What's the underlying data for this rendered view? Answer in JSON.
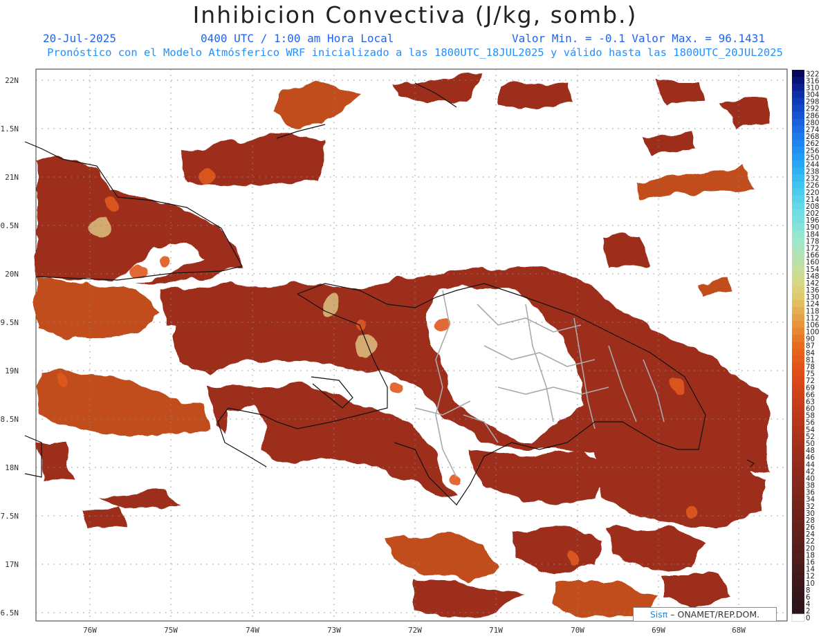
{
  "header": {
    "title": "Inhibicion Convectiva (J/kg, somb.)",
    "date": "20-Jul-2025",
    "valid_time": "0400 UTC / 1:00 am Hora Local",
    "min_max": "Valor Min. = -0.1  Valor Max. = 96.1431",
    "model_info": "Pronóstico con el Modelo Atmósferico WRF inicializado a las 1800UTC_18JUL2025 y válido hasta las  1800UTC_20JUL2025"
  },
  "colors": {
    "header_text": "#1e64f0",
    "model_text": "#1e90ff",
    "field_dark": "#9e2f1a",
    "field_mid": "#c24e1c",
    "field_bright": "#e05a1e",
    "field_light": "#d8b97a",
    "coast": "#111111",
    "borders": "#aaaaaa"
  },
  "map": {
    "lat_labels": [
      "22N",
      "1.5N",
      "21N",
      "0.5N",
      "20N",
      "9.5N",
      "19N",
      "8.5N",
      "18N",
      "7.5N",
      "17N",
      "6.5N"
    ],
    "lon_labels": [
      "76W",
      "75W",
      "74W",
      "73W",
      "72W",
      "71W",
      "70W",
      "69W",
      "68W"
    ]
  },
  "colorbar": {
    "labels": [
      "322",
      "316",
      "310",
      "304",
      "298",
      "292",
      "286",
      "280",
      "274",
      "268",
      "262",
      "256",
      "250",
      "244",
      "238",
      "232",
      "226",
      "220",
      "214",
      "208",
      "202",
      "196",
      "190",
      "184",
      "178",
      "172",
      "166",
      "160",
      "154",
      "148",
      "142",
      "136",
      "130",
      "124",
      "118",
      "112",
      "106",
      "100",
      "90",
      "87",
      "84",
      "81",
      "78",
      "75",
      "72",
      "69",
      "66",
      "63",
      "60",
      "58",
      "56",
      "54",
      "52",
      "50",
      "48",
      "46",
      "44",
      "42",
      "40",
      "38",
      "36",
      "34",
      "32",
      "30",
      "28",
      "26",
      "24",
      "22",
      "20",
      "18",
      "16",
      "14",
      "12",
      "10",
      "8",
      "6",
      "4",
      "2",
      "0"
    ],
    "colors": [
      "#06065e",
      "#081378",
      "#0a2090",
      "#0c2ea6",
      "#0e3cb8",
      "#1148c8",
      "#1554d6",
      "#1960e0",
      "#1c6ce8",
      "#1e78ee",
      "#1f84f2",
      "#2090f5",
      "#229bf6",
      "#27a6f6",
      "#2eb1f5",
      "#36bbf3",
      "#40c4f0",
      "#4bcced",
      "#57d3ea",
      "#63d8e6",
      "#6fdde2",
      "#7ae0dd",
      "#86e3d8",
      "#92e6d2",
      "#9de7cb",
      "#a7e5c2",
      "#b1e3b7",
      "#bbe1ab",
      "#c5df9f",
      "#cedc92",
      "#d6d885",
      "#dcd178",
      "#e0c86c",
      "#e3bd60",
      "#e5b054",
      "#e6a248",
      "#e7943c",
      "#e88631",
      "#e87828",
      "#e86c20",
      "#e8621c",
      "#e65a1a",
      "#e4521a",
      "#e04c1a",
      "#dc481a",
      "#d6441a",
      "#d0411a",
      "#ca3e1a",
      "#c43b1a",
      "#be381a",
      "#b8361a",
      "#b2341a",
      "#ac321a",
      "#a6301a",
      "#a02e1a",
      "#9a2c1a",
      "#942a1a",
      "#8f291b",
      "#8a281b",
      "#85271b",
      "#80261b",
      "#7b251b",
      "#76241b",
      "#70231b",
      "#6b221b",
      "#66211b",
      "#61201b",
      "#5c1f1b",
      "#571e1b",
      "#521d1b",
      "#4d1c1b",
      "#481b1b",
      "#431a1b",
      "#3e191b",
      "#39181b",
      "#34171b",
      "#2f161b",
      "#2a151b",
      "#ffffff"
    ]
  },
  "credit": {
    "brand": "Sisπ",
    "org": " – ONAMET/REP.DOM."
  }
}
